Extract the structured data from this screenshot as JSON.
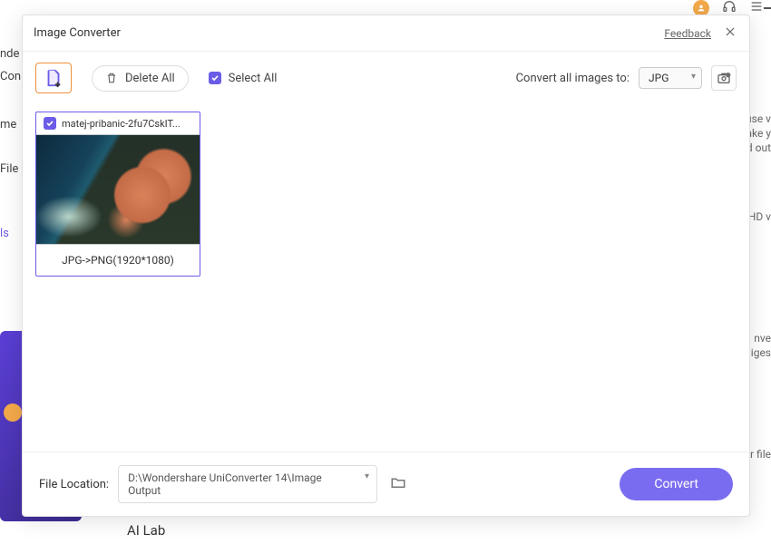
{
  "modal": {
    "title": "Image Converter",
    "feedback": "Feedback"
  },
  "toolbar": {
    "delete_all": "Delete All",
    "select_all": "Select All",
    "convert_label": "Convert all images to:",
    "format": "JPG"
  },
  "items": [
    {
      "filename": "matej-pribanic-2fu7CskIT...",
      "conversion": "JPG->PNG(1920*1080)"
    }
  ],
  "footer": {
    "location_label": "File Location:",
    "path": "D:\\Wondershare UniConverter 14\\Image Output",
    "convert": "Convert"
  },
  "background": {
    "sidebar": [
      "nde",
      "Con",
      "me",
      "File",
      "ls"
    ],
    "bottom_item": "AI Lab",
    "right_snippets": [
      "use v",
      "ake y",
      "d out",
      "HD v",
      "nve",
      "iges",
      "ir file"
    ]
  }
}
